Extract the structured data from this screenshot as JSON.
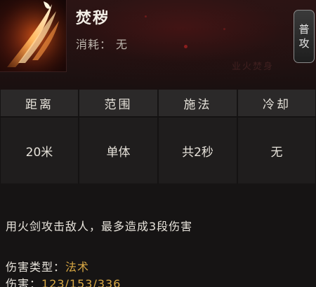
{
  "skill": {
    "name": "焚秽",
    "cost_label": "消耗：",
    "cost_value": "无",
    "type_badge": [
      "普",
      "攻"
    ],
    "faint_text": "业火焚身"
  },
  "stats": {
    "headers": [
      "距离",
      "范围",
      "施法",
      "冷却"
    ],
    "values": [
      "20米",
      "单体",
      "共2秒",
      "无"
    ]
  },
  "description": "用火剑攻击敌人，最多造成3段伤害",
  "damage_type": {
    "label": "伤害类型：",
    "value": "法术"
  },
  "damage": {
    "label": "伤害：",
    "value": "123/153/336"
  },
  "colors": {
    "accent_gold": "#d9a844",
    "header_bg": "#2b2929",
    "panel_bg": "#161414"
  },
  "icons": [
    "fire-sword-slash-icon"
  ]
}
